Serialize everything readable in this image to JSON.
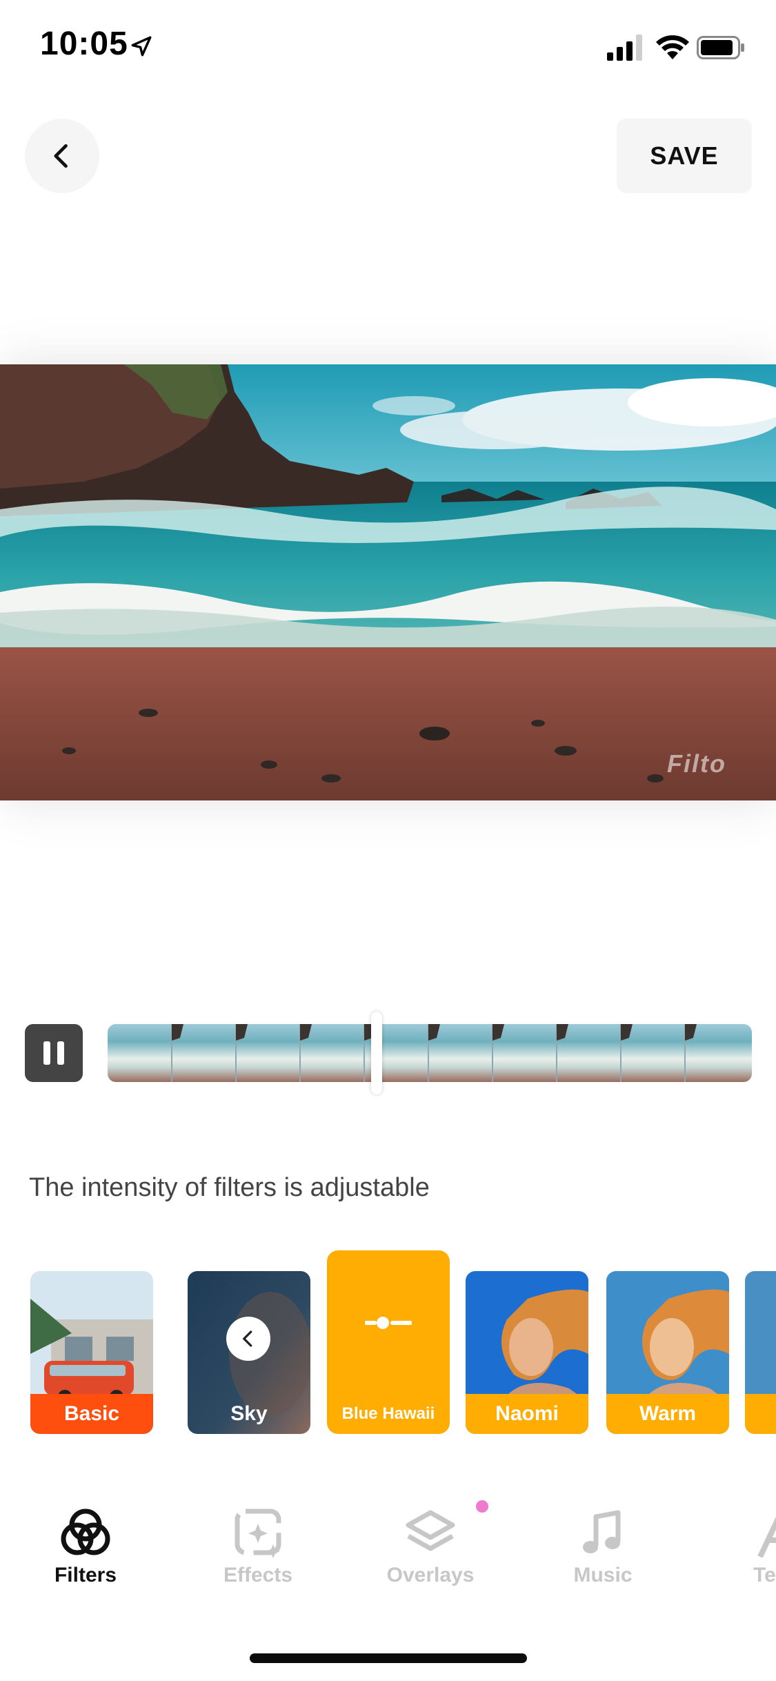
{
  "status_bar": {
    "time": "10:05"
  },
  "header": {
    "save_label": "SAVE"
  },
  "preview": {
    "watermark": "Filto"
  },
  "hint": "The intensity of filters is adjustable",
  "filters": [
    {
      "label": "Basic",
      "label_color": "#ff4f0f"
    },
    {
      "label": "Sky"
    },
    {
      "label": "Blue Hawaii",
      "selected": true,
      "color": "#ffad02"
    },
    {
      "label": "Naomi",
      "label_color": "#ffad02"
    },
    {
      "label": "Warm",
      "label_color": "#ffad02"
    }
  ],
  "tabs": [
    {
      "label": "Filters",
      "icon": "filters-icon",
      "active": true
    },
    {
      "label": "Effects",
      "icon": "effects-icon"
    },
    {
      "label": "Overlays",
      "icon": "overlays-icon",
      "badge": "new-dot"
    },
    {
      "label": "Music",
      "icon": "music-note-icon"
    },
    {
      "label": "Te",
      "icon": "text-icon"
    }
  ],
  "colors": {
    "accent": "#ffad02",
    "basic": "#ff4f0f",
    "badge": "#ef7bd0"
  }
}
